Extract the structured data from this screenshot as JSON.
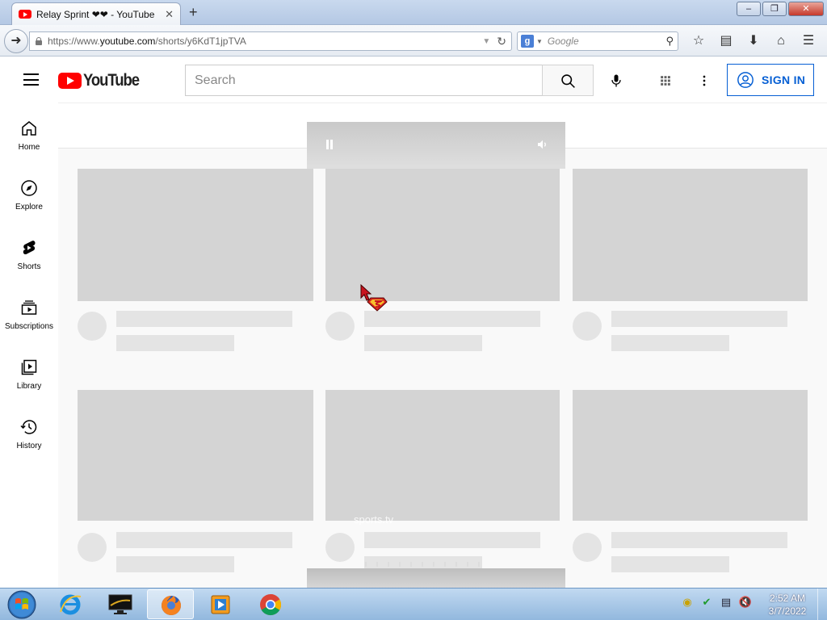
{
  "browser": {
    "tab_title": "Relay Sprint ❤❤ - YouTube",
    "tab_close": "✕",
    "new_tab": "+",
    "window_buttons": {
      "minimize": "–",
      "restore": "❐",
      "close": "✕"
    },
    "url_prefix": "https://www.",
    "url_domain": "youtube.com",
    "url_path": "/shorts/y6KdT1jpTVA",
    "search_engine_label": "g",
    "search_placeholder": "Google"
  },
  "youtube": {
    "logo_text": "YouTube",
    "search_placeholder": "Search",
    "sign_in_label": "SIGN IN",
    "sidebar": [
      {
        "label": "Home",
        "icon": "home-icon"
      },
      {
        "label": "Explore",
        "icon": "compass-icon"
      },
      {
        "label": "Shorts",
        "icon": "shorts-icon"
      },
      {
        "label": "Subscriptions",
        "icon": "subscriptions-icon"
      },
      {
        "label": "Library",
        "icon": "library-icon"
      },
      {
        "label": "History",
        "icon": "history-icon"
      }
    ],
    "overlay_text": "sports.tv"
  },
  "taskbar": {
    "clock_time": "2:52 AM",
    "clock_date": "3/7/2022",
    "apps": [
      "internet-explorer",
      "media-center",
      "firefox",
      "media-player",
      "chrome"
    ]
  },
  "colors": {
    "youtube_red": "#ff0000",
    "sign_in_blue": "#065fd4",
    "skeleton": "#d4d4d4"
  }
}
